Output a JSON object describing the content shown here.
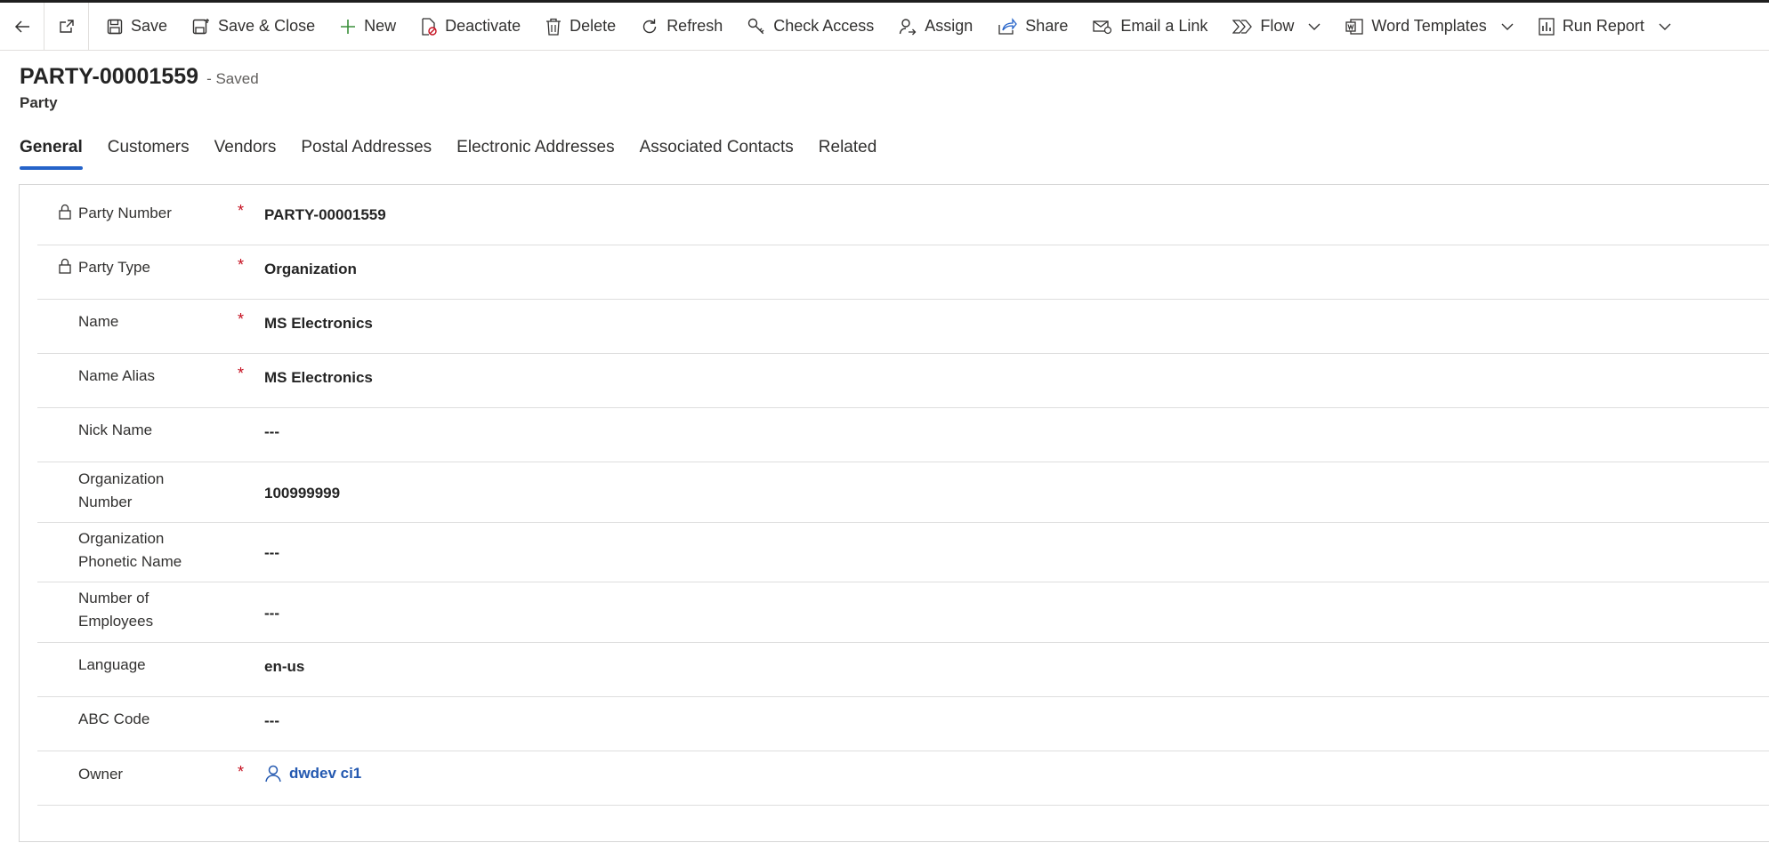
{
  "commandbar": {
    "save": "Save",
    "save_close": "Save & Close",
    "new": "New",
    "deactivate": "Deactivate",
    "delete": "Delete",
    "refresh": "Refresh",
    "check_access": "Check Access",
    "assign": "Assign",
    "share": "Share",
    "email_link": "Email a Link",
    "flow": "Flow",
    "word_templates": "Word Templates",
    "run_report": "Run Report"
  },
  "header": {
    "title": "PARTY-00001559",
    "status": "- Saved",
    "entity": "Party"
  },
  "tabs": [
    "General",
    "Customers",
    "Vendors",
    "Postal Addresses",
    "Electronic Addresses",
    "Associated Contacts",
    "Related"
  ],
  "fields": {
    "party_number": {
      "label": "Party Number",
      "value": "PARTY-00001559",
      "required": "*"
    },
    "party_type": {
      "label": "Party Type",
      "value": "Organization",
      "required": "*"
    },
    "name": {
      "label": "Name",
      "value": "MS Electronics",
      "required": "*"
    },
    "name_alias": {
      "label": "Name Alias",
      "value": "MS Electronics",
      "required": "*"
    },
    "nick_name": {
      "label": "Nick Name",
      "value": "---"
    },
    "org_number": {
      "label_1": "Organization",
      "label_2": "Number",
      "value": "100999999"
    },
    "org_phonetic": {
      "label_1": "Organization",
      "label_2": "Phonetic Name",
      "value": "---"
    },
    "num_employees": {
      "label_1": "Number of",
      "label_2": "Employees",
      "value": "---"
    },
    "language": {
      "label": "Language",
      "value": "en-us"
    },
    "abc_code": {
      "label": "ABC Code",
      "value": "---"
    },
    "owner": {
      "label": "Owner",
      "value": "dwdev ci1",
      "required": "*"
    }
  },
  "colors": {
    "accent": "#2563c9",
    "link": "#2358b0",
    "required": "#c50f1f"
  },
  "icons": [
    "back-arrow-icon",
    "popout-icon",
    "save-icon",
    "save-close-icon",
    "plus-icon",
    "deactivate-icon",
    "trash-icon",
    "refresh-icon",
    "key-icon",
    "assign-user-icon",
    "share-icon",
    "email-link-icon",
    "flow-icon",
    "word-icon",
    "report-icon",
    "chevron-down-icon",
    "lock-icon",
    "user-icon"
  ]
}
